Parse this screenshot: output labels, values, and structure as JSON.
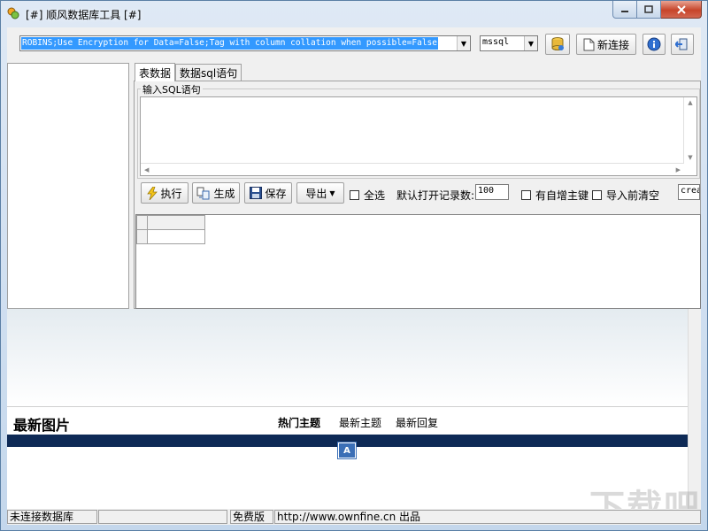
{
  "window": {
    "title": "[#] 顺风数据库工具 [#]"
  },
  "toolbar": {
    "connection_string": "ROBINS;Use Encryption for Data=False;Tag with column collation when possible=False",
    "db_type": "mssql",
    "new_connection_label": "新连接"
  },
  "tabs": [
    {
      "label": "表数据",
      "active": true
    },
    {
      "label": "数据sql语句",
      "active": false
    }
  ],
  "sql_group": {
    "legend": "输入SQL语句"
  },
  "actions": {
    "execute_label": "执行",
    "generate_label": "生成",
    "save_label": "保存",
    "export_label": "导出",
    "select_all_label": "全选",
    "default_records_label": "默认打开记录数:",
    "default_records_value": "100",
    "auto_increment_label": "有自增主键",
    "clear_before_import_label": "导入前清空",
    "create_value": "create"
  },
  "lower": {
    "news_title": "最新图片",
    "news_tabs": [
      "热门主题",
      "最新主题",
      "最新回复"
    ],
    "badge_letter": "A"
  },
  "watermark": "下载吧",
  "status": {
    "connection": "未连接数据库",
    "empty_panel": "",
    "edition": "免费版",
    "website": "http://www.ownfine.cn 出品"
  }
}
